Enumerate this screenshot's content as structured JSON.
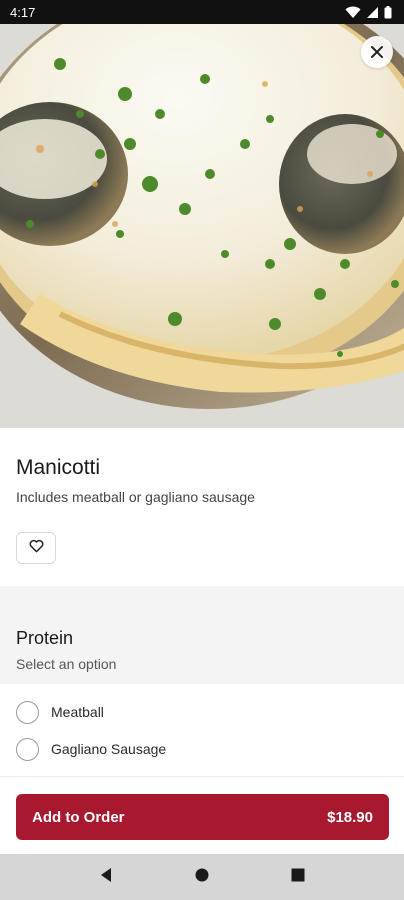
{
  "status_bar": {
    "time": "4:17",
    "icons": [
      "wifi-icon",
      "signal-icon",
      "battery-icon"
    ]
  },
  "hero": {
    "image": "manicotti-dish-photo",
    "close_icon": "close-icon"
  },
  "item": {
    "title": "Manicotti",
    "description": "Includes meatball or gagliano sausage",
    "favorite_icon": "heart-icon"
  },
  "modifier_group": {
    "title": "Protein",
    "subtitle": "Select an option",
    "options": [
      {
        "label": "Meatball",
        "selected": false
      },
      {
        "label": "Gagliano Sausage",
        "selected": false
      }
    ]
  },
  "order_bar": {
    "button_label": "Add to Order",
    "price": "$18.90"
  },
  "nav_bar": {
    "buttons": [
      "back-icon",
      "home-icon",
      "recents-icon"
    ]
  },
  "colors": {
    "accent": "#a8182f",
    "section_bg": "#f4f4f4",
    "nav_bg": "#d6d6d6"
  }
}
